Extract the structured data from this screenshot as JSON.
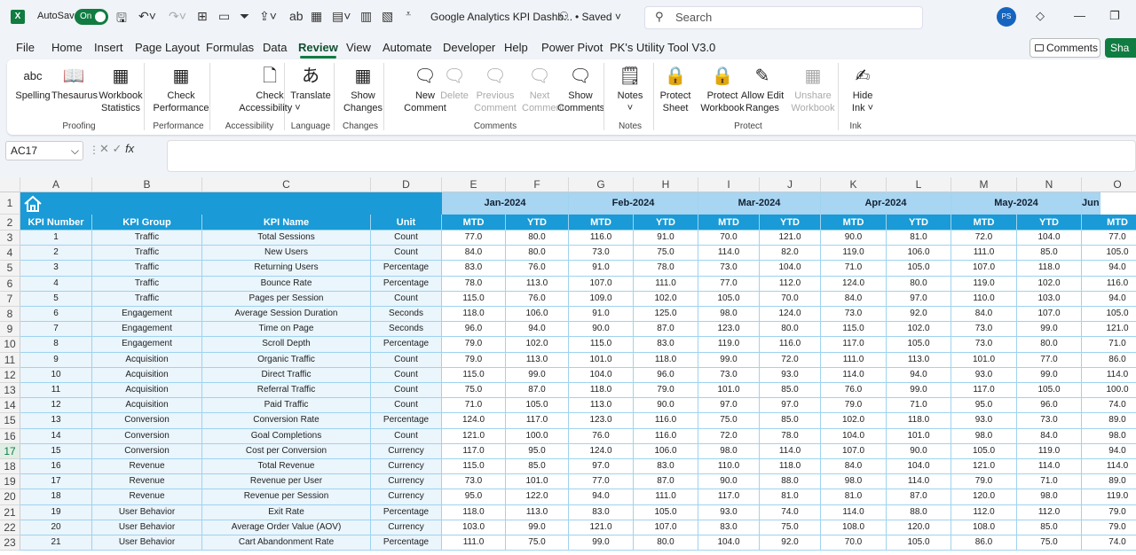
{
  "titlebar": {
    "app_icon": "excel-icon",
    "autosave_label": "AutoSave",
    "autosave_state": "On",
    "doc_title": "Google Analytics KPI Dashb...",
    "saved_status": "• Saved ˅",
    "search_placeholder": "Search",
    "avatar_initials": "PS"
  },
  "menu_tabs": [
    "File",
    "Home",
    "Insert",
    "Page Layout",
    "Formulas",
    "Data",
    "Review",
    "View",
    "Automate",
    "Developer",
    "Help",
    "Power Pivot",
    "PK's Utility Tool V3.0"
  ],
  "active_tab": "Review",
  "comments_button": "Comments",
  "share_button": "Sha",
  "ribbon": {
    "buttons": [
      {
        "label": "Spelling",
        "icon": "spelling-icon",
        "disabled": false
      },
      {
        "label": "Thesaurus",
        "icon": "thesaurus-icon",
        "disabled": false
      },
      {
        "label": "Workbook Statistics",
        "icon": "workbook-statistics-icon",
        "disabled": false
      },
      {
        "label": "Check Performance",
        "icon": "check-performance-icon",
        "disabled": false
      },
      {
        "label": "Check Accessibility ˅",
        "icon": "accessibility-icon",
        "disabled": false
      },
      {
        "label": "Translate",
        "icon": "translate-icon",
        "disabled": false
      },
      {
        "label": "Show Changes",
        "icon": "show-changes-icon",
        "disabled": false
      },
      {
        "label": "New Comment",
        "icon": "new-comment-icon",
        "disabled": false
      },
      {
        "label": "Delete",
        "icon": "delete-comment-icon",
        "disabled": true
      },
      {
        "label": "Previous Comment",
        "icon": "previous-comment-icon",
        "disabled": true
      },
      {
        "label": "Next Comment",
        "icon": "next-comment-icon",
        "disabled": true
      },
      {
        "label": "Show Comments",
        "icon": "show-comments-icon",
        "disabled": false
      },
      {
        "label": "Notes ˅",
        "icon": "notes-icon",
        "disabled": false
      },
      {
        "label": "Protect Sheet",
        "icon": "protect-sheet-icon",
        "disabled": false
      },
      {
        "label": "Protect Workbook",
        "icon": "protect-workbook-icon",
        "disabled": false
      },
      {
        "label": "Allow Edit Ranges",
        "icon": "allow-edit-ranges-icon",
        "disabled": false
      },
      {
        "label": "Unshare Workbook",
        "icon": "unshare-workbook-icon",
        "disabled": true
      },
      {
        "label": "Hide Ink ˅",
        "icon": "hide-ink-icon",
        "disabled": false
      }
    ],
    "groups": [
      "Proofing",
      "Performance",
      "Accessibility",
      "Language",
      "Changes",
      "Comments",
      "Notes",
      "Protect",
      "Ink"
    ]
  },
  "formula_bar": {
    "name_box": "AC17",
    "fx": "fx",
    "value": ""
  },
  "sheet": {
    "columns": [
      "A",
      "B",
      "C",
      "D",
      "E",
      "F",
      "G",
      "H",
      "I",
      "J",
      "K",
      "L",
      "M",
      "N",
      "O"
    ],
    "row_numbers": [
      "1",
      "2",
      "3",
      "4",
      "5",
      "6",
      "7",
      "8",
      "9",
      "10",
      "11",
      "12",
      "13",
      "14",
      "15",
      "16",
      "17",
      "18",
      "19",
      "20",
      "21",
      "22",
      "23"
    ],
    "selected_row": "17",
    "home_icon": "home-icon",
    "months": [
      "Jan-2024",
      "Feb-2024",
      "Mar-2024",
      "Apr-2024",
      "May-2024",
      "Jun"
    ],
    "headers": [
      "KPI Number",
      "KPI Group",
      "KPI Name",
      "Unit",
      "MTD",
      "YTD",
      "MTD",
      "YTD",
      "MTD",
      "YTD",
      "MTD",
      "YTD",
      "MTD",
      "YTD",
      "MTD"
    ],
    "rows": [
      [
        "1",
        "Traffic",
        "Total Sessions",
        "Count",
        "77.0",
        "80.0",
        "116.0",
        "91.0",
        "70.0",
        "121.0",
        "90.0",
        "81.0",
        "72.0",
        "104.0",
        "77.0"
      ],
      [
        "2",
        "Traffic",
        "New Users",
        "Count",
        "84.0",
        "80.0",
        "73.0",
        "75.0",
        "114.0",
        "82.0",
        "119.0",
        "106.0",
        "111.0",
        "85.0",
        "105.0"
      ],
      [
        "3",
        "Traffic",
        "Returning Users",
        "Percentage",
        "83.0",
        "76.0",
        "91.0",
        "78.0",
        "73.0",
        "104.0",
        "71.0",
        "105.0",
        "107.0",
        "118.0",
        "94.0"
      ],
      [
        "4",
        "Traffic",
        "Bounce Rate",
        "Percentage",
        "78.0",
        "113.0",
        "107.0",
        "111.0",
        "77.0",
        "112.0",
        "124.0",
        "80.0",
        "119.0",
        "102.0",
        "116.0"
      ],
      [
        "5",
        "Traffic",
        "Pages per Session",
        "Count",
        "115.0",
        "76.0",
        "109.0",
        "102.0",
        "105.0",
        "70.0",
        "84.0",
        "97.0",
        "110.0",
        "103.0",
        "94.0"
      ],
      [
        "6",
        "Engagement",
        "Average Session Duration",
        "Seconds",
        "118.0",
        "106.0",
        "91.0",
        "125.0",
        "98.0",
        "124.0",
        "73.0",
        "92.0",
        "84.0",
        "107.0",
        "105.0"
      ],
      [
        "7",
        "Engagement",
        "Time on Page",
        "Seconds",
        "96.0",
        "94.0",
        "90.0",
        "87.0",
        "123.0",
        "80.0",
        "115.0",
        "102.0",
        "73.0",
        "99.0",
        "121.0"
      ],
      [
        "8",
        "Engagement",
        "Scroll Depth",
        "Percentage",
        "79.0",
        "102.0",
        "115.0",
        "83.0",
        "119.0",
        "116.0",
        "117.0",
        "105.0",
        "73.0",
        "80.0",
        "71.0"
      ],
      [
        "9",
        "Acquisition",
        "Organic Traffic",
        "Count",
        "79.0",
        "113.0",
        "101.0",
        "118.0",
        "99.0",
        "72.0",
        "111.0",
        "113.0",
        "101.0",
        "77.0",
        "86.0"
      ],
      [
        "10",
        "Acquisition",
        "Direct Traffic",
        "Count",
        "115.0",
        "99.0",
        "104.0",
        "96.0",
        "73.0",
        "93.0",
        "114.0",
        "94.0",
        "93.0",
        "99.0",
        "114.0"
      ],
      [
        "11",
        "Acquisition",
        "Referral Traffic",
        "Count",
        "75.0",
        "87.0",
        "118.0",
        "79.0",
        "101.0",
        "85.0",
        "76.0",
        "99.0",
        "117.0",
        "105.0",
        "100.0"
      ],
      [
        "12",
        "Acquisition",
        "Paid Traffic",
        "Count",
        "71.0",
        "105.0",
        "113.0",
        "90.0",
        "97.0",
        "97.0",
        "79.0",
        "71.0",
        "95.0",
        "96.0",
        "74.0"
      ],
      [
        "13",
        "Conversion",
        "Conversion Rate",
        "Percentage",
        "124.0",
        "117.0",
        "123.0",
        "116.0",
        "75.0",
        "85.0",
        "102.0",
        "118.0",
        "93.0",
        "73.0",
        "89.0"
      ],
      [
        "14",
        "Conversion",
        "Goal Completions",
        "Count",
        "121.0",
        "100.0",
        "76.0",
        "116.0",
        "72.0",
        "78.0",
        "104.0",
        "101.0",
        "98.0",
        "84.0",
        "98.0"
      ],
      [
        "15",
        "Conversion",
        "Cost per Conversion",
        "Currency",
        "117.0",
        "95.0",
        "124.0",
        "106.0",
        "98.0",
        "114.0",
        "107.0",
        "90.0",
        "105.0",
        "119.0",
        "94.0"
      ],
      [
        "16",
        "Revenue",
        "Total Revenue",
        "Currency",
        "115.0",
        "85.0",
        "97.0",
        "83.0",
        "110.0",
        "118.0",
        "84.0",
        "104.0",
        "121.0",
        "114.0",
        "114.0"
      ],
      [
        "17",
        "Revenue",
        "Revenue per User",
        "Currency",
        "73.0",
        "101.0",
        "77.0",
        "87.0",
        "90.0",
        "88.0",
        "98.0",
        "114.0",
        "79.0",
        "71.0",
        "89.0"
      ],
      [
        "18",
        "Revenue",
        "Revenue per Session",
        "Currency",
        "95.0",
        "122.0",
        "94.0",
        "111.0",
        "117.0",
        "81.0",
        "81.0",
        "87.0",
        "120.0",
        "98.0",
        "119.0"
      ],
      [
        "19",
        "User Behavior",
        "Exit Rate",
        "Percentage",
        "118.0",
        "113.0",
        "83.0",
        "105.0",
        "93.0",
        "74.0",
        "114.0",
        "88.0",
        "112.0",
        "112.0",
        "79.0"
      ],
      [
        "20",
        "User Behavior",
        "Average Order Value (AOV)",
        "Currency",
        "103.0",
        "99.0",
        "121.0",
        "107.0",
        "83.0",
        "75.0",
        "108.0",
        "120.0",
        "108.0",
        "85.0",
        "79.0"
      ],
      [
        "21",
        "User Behavior",
        "Cart Abandonment Rate",
        "Percentage",
        "111.0",
        "75.0",
        "99.0",
        "80.0",
        "104.0",
        "92.0",
        "70.0",
        "105.0",
        "86.0",
        "75.0",
        "74.0"
      ]
    ]
  }
}
